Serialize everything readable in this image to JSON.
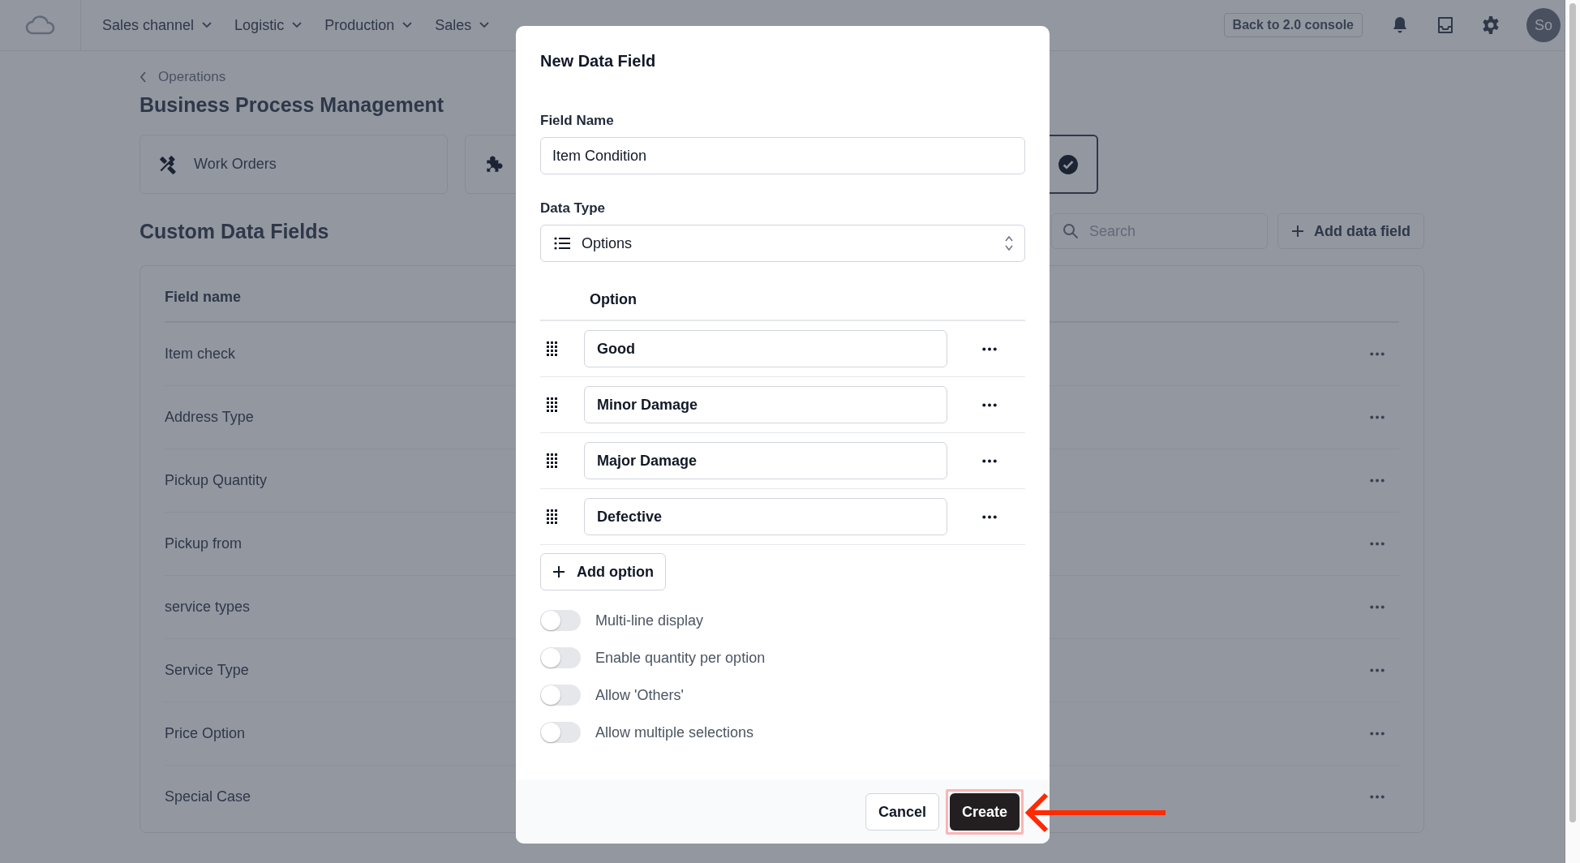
{
  "top_bar": {
    "nav": [
      {
        "label": "Sales channel"
      },
      {
        "label": "Logistic"
      },
      {
        "label": "Production"
      },
      {
        "label": "Sales"
      }
    ],
    "console_button": "Back to 2.0 console",
    "avatar": "So"
  },
  "breadcrumb": "Operations",
  "page_title": "Business Process Management",
  "process_cards": [
    {
      "label": "Work Orders",
      "selected": false
    },
    {
      "selected": false
    },
    {
      "selected": true
    }
  ],
  "custom_fields": {
    "title": "Custom Data Fields",
    "search": {
      "placeholder": "Search"
    },
    "add_button": "Add data field",
    "columns": [
      "Field name"
    ],
    "rows": [
      "Item check",
      "Address Type",
      "Pickup Quantity",
      "Pickup from",
      "service types",
      "Service Type",
      "Price Option",
      "Special Case"
    ]
  },
  "dialog": {
    "title": "New Data Field",
    "field_name": {
      "label": "Field Name",
      "value": "Item Condition"
    },
    "data_type": {
      "label": "Data Type",
      "value": "Options"
    },
    "options_header": "Option",
    "options": [
      "Good",
      "Minor Damage",
      "Major Damage",
      "Defective"
    ],
    "add_option": "Add option",
    "toggles": [
      {
        "label": "Multi-line display",
        "on": false
      },
      {
        "label": "Enable quantity per option",
        "on": false
      },
      {
        "label": "Allow 'Others'",
        "on": false
      },
      {
        "label": "Allow multiple selections",
        "on": false
      }
    ],
    "buttons": {
      "cancel": "Cancel",
      "create": "Create"
    }
  }
}
